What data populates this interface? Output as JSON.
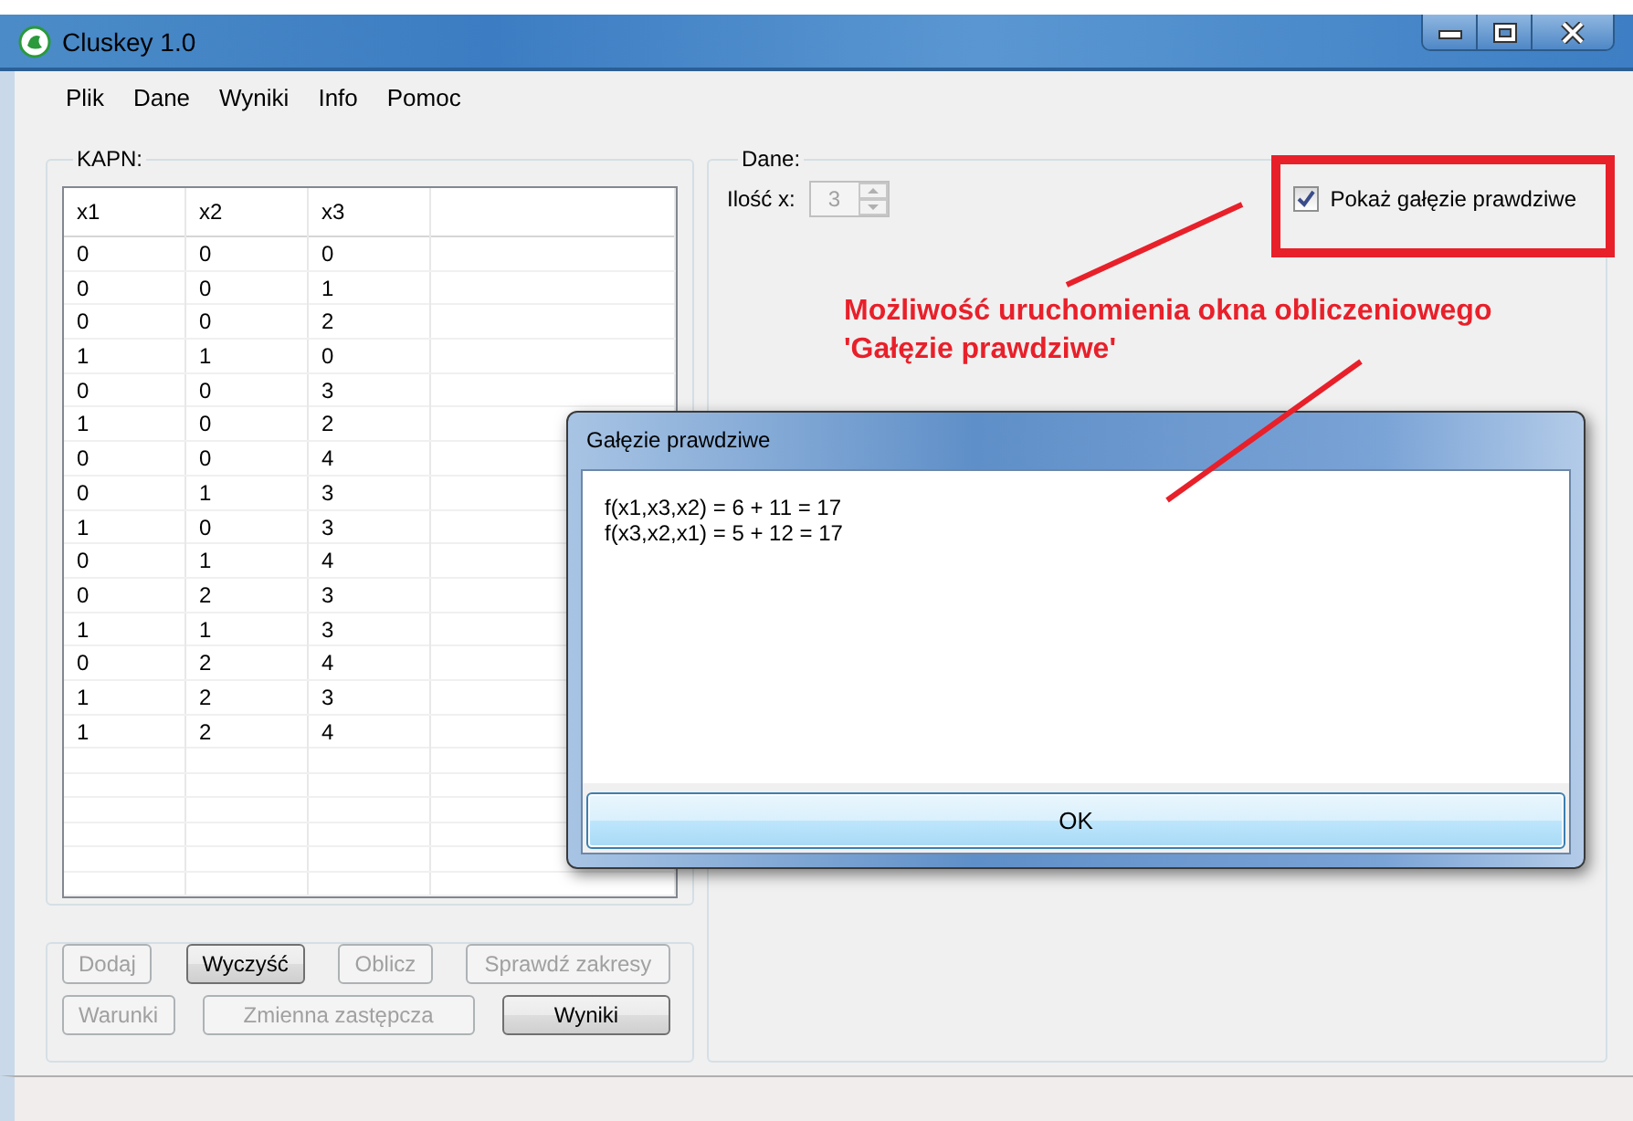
{
  "window": {
    "title": "Cluskey 1.0"
  },
  "menu": [
    "Plik",
    "Dane",
    "Wyniki",
    "Info",
    "Pomoc"
  ],
  "kapn": {
    "title": "KAPN:",
    "columns": [
      "x1",
      "x2",
      "x3"
    ],
    "rows": [
      [
        "0",
        "0",
        "0"
      ],
      [
        "0",
        "0",
        "1"
      ],
      [
        "0",
        "0",
        "2"
      ],
      [
        "1",
        "1",
        "0"
      ],
      [
        "0",
        "0",
        "3"
      ],
      [
        "1",
        "0",
        "2"
      ],
      [
        "0",
        "0",
        "4"
      ],
      [
        "0",
        "1",
        "3"
      ],
      [
        "1",
        "0",
        "3"
      ],
      [
        "0",
        "1",
        "4"
      ],
      [
        "0",
        "2",
        "3"
      ],
      [
        "1",
        "1",
        "3"
      ],
      [
        "0",
        "2",
        "4"
      ],
      [
        "1",
        "2",
        "3"
      ],
      [
        "1",
        "2",
        "4"
      ]
    ]
  },
  "button_rows": [
    [
      {
        "label": "Dodaj",
        "disabled": true
      },
      {
        "label": "Wyczyść",
        "disabled": false
      },
      {
        "label": "Oblicz",
        "disabled": true
      },
      {
        "label": "Sprawdź zakresy",
        "disabled": true
      }
    ],
    [
      {
        "label": "Warunki",
        "disabled": true
      },
      {
        "label": "Zmienna zastępcza",
        "disabled": true
      },
      {
        "label": "Wyniki",
        "disabled": false
      }
    ]
  ],
  "dane": {
    "title": "Dane:",
    "count": {
      "label": "Ilość x:",
      "value": "3",
      "disabled": true
    },
    "show_branches": {
      "label": "Pokaż gałęzie prawdziwe",
      "checked": true
    }
  },
  "annotation": {
    "lines": [
      "Możliwość uruchomienia okna obliczeniowego",
      "'Gałęzie prawdziwe'"
    ]
  },
  "dialog": {
    "title": "Gałęzie prawdziwe",
    "lines": [
      "f(x1,x3,x2) = 6 + 11 = 17",
      "f(x3,x2,x1) = 5 + 12 = 17"
    ],
    "button": "OK"
  }
}
